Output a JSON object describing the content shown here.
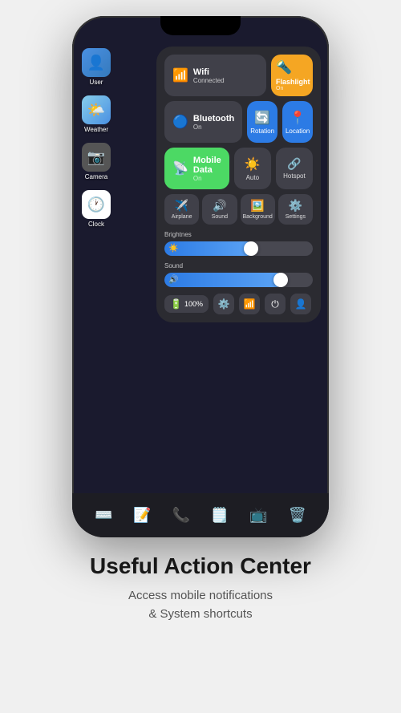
{
  "phone": {
    "notch": true
  },
  "apps": [
    {
      "id": "user",
      "label": "User",
      "icon": "👤",
      "class": "app-user"
    },
    {
      "id": "weather",
      "label": "Weather",
      "icon": "🌤️",
      "class": "app-weather"
    },
    {
      "id": "camera",
      "label": "Camera",
      "icon": "📷",
      "class": "app-camera"
    },
    {
      "id": "clock",
      "label": "Clock",
      "icon": "🕐",
      "class": "app-clock"
    }
  ],
  "control_center": {
    "wifi": {
      "label": "Wifi",
      "status": "Connected",
      "active": true
    },
    "flashlight": {
      "label": "Flashlight",
      "status": "On",
      "active": true
    },
    "bluetooth": {
      "label": "Bluetooth",
      "status": "On",
      "active": true
    },
    "rotation": {
      "label": "Rotation",
      "active": true
    },
    "location": {
      "label": "Location",
      "active": true
    },
    "mobile_data": {
      "label": "Mobile Data",
      "status": "On",
      "active": true
    },
    "auto": {
      "label": "Auto",
      "active": false
    },
    "hotspot": {
      "label": "Hotspot",
      "active": false
    },
    "airplane": {
      "label": "Airplane",
      "active": false
    },
    "sound": {
      "label": "Sound",
      "active": false
    },
    "background": {
      "label": "Background",
      "active": false
    },
    "settings": {
      "label": "Settings",
      "active": false
    },
    "brightness": {
      "label": "Brightnes",
      "value": 60
    },
    "sound_slider": {
      "label": "Sound",
      "value": 80
    },
    "battery": {
      "label": "100%",
      "icon": "🔋"
    }
  },
  "dock_icons": [
    "⌨️",
    "📝",
    "📞",
    "🗒️",
    "📺",
    "🗑️"
  ],
  "footer": {
    "title": "Useful Action Center",
    "subtitle": "Access mobile notifications\n& System shortcuts"
  }
}
